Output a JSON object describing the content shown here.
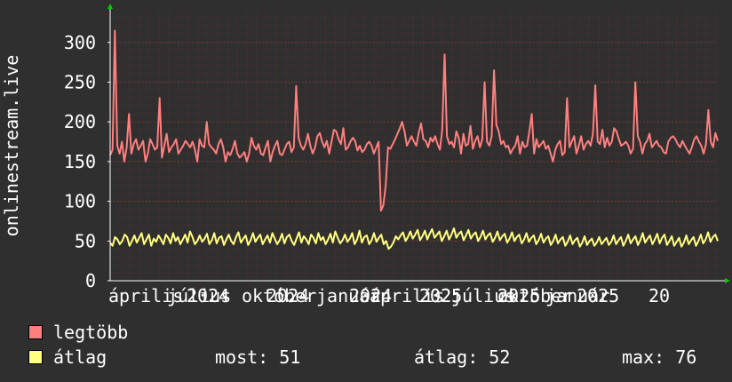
{
  "chart_data": {
    "type": "line",
    "ylabel": "onlinestream.live",
    "ylim": [
      0,
      340
    ],
    "y_ticks": [
      0,
      50,
      100,
      150,
      200,
      250,
      300
    ],
    "x_tick_labels": [
      "április",
      "2024",
      "július",
      "2024",
      "október",
      "2024",
      "január",
      "2025",
      "április",
      "2025",
      "július",
      "2025",
      "október",
      "2025",
      "január",
      "20"
    ],
    "grid": true,
    "legend_placement": "bottom-left",
    "series": [
      {
        "name": "legtöbb",
        "color": "#ff7f7f",
        "values": [
          158,
          165,
          315,
          170,
          160,
          175,
          150,
          168,
          210,
          160,
          172,
          178,
          165,
          170,
          176,
          150,
          160,
          178,
          172,
          165,
          168,
          230,
          155,
          170,
          185,
          162,
          168,
          172,
          178,
          160,
          165,
          170,
          176,
          172,
          168,
          175,
          165,
          150,
          178,
          170,
          168,
          200,
          172,
          168,
          165,
          160,
          172,
          178,
          168,
          150,
          162,
          158,
          166,
          176,
          160,
          155,
          158,
          162,
          150,
          160,
          180,
          170,
          165,
          172,
          160,
          158,
          168,
          176,
          150,
          162,
          170,
          176,
          160,
          158,
          165,
          172,
          175,
          162,
          168,
          245,
          180,
          170,
          165,
          172,
          185,
          170,
          160,
          168,
          182,
          186,
          175,
          168,
          176,
          160,
          175,
          190,
          188,
          178,
          172,
          192,
          165,
          168,
          175,
          180,
          176,
          164,
          170,
          162,
          165,
          172,
          175,
          170,
          160,
          168,
          175,
          88,
          95,
          120,
          168,
          166,
          172,
          178,
          185,
          192,
          200,
          188,
          170,
          176,
          182,
          175,
          170,
          186,
          198,
          178,
          176,
          168,
          180,
          175,
          182,
          172,
          165,
          190,
          285,
          182,
          172,
          175,
          168,
          188,
          180,
          160,
          185,
          170,
          172,
          195,
          166,
          176,
          182,
          168,
          178,
          250,
          175,
          170,
          182,
          265,
          196,
          188,
          172,
          176,
          168,
          170,
          160,
          166,
          170,
          182,
          160,
          175,
          168,
          170,
          188,
          210,
          160,
          178,
          168,
          172,
          176,
          166,
          170,
          160,
          150,
          165,
          172,
          176,
          158,
          162,
          230,
          168,
          175,
          182,
          160,
          170,
          182,
          165,
          172,
          176,
          170,
          185,
          246,
          175,
          172,
          190,
          168,
          180,
          170,
          175,
          192,
          188,
          178,
          170,
          172,
          175,
          170,
          160,
          166,
          250,
          182,
          175,
          160,
          172,
          176,
          185,
          168,
          172,
          176,
          170,
          168,
          162,
          160,
          175,
          180,
          182,
          178,
          172,
          168,
          176,
          170,
          165,
          160,
          168,
          178,
          182,
          175,
          170,
          160,
          172,
          215,
          175,
          168,
          186,
          176
        ]
      },
      {
        "name": "átlag",
        "color": "#ffff80",
        "values": [
          48,
          44,
          55,
          52,
          46,
          50,
          58,
          55,
          44,
          50,
          57,
          48,
          54,
          60,
          46,
          52,
          58,
          44,
          53,
          49,
          57,
          52,
          46,
          58,
          54,
          47,
          60,
          50,
          55,
          46,
          52,
          58,
          48,
          62,
          55,
          46,
          50,
          57,
          49,
          53,
          59,
          46,
          51,
          60,
          47,
          54,
          56,
          45,
          52,
          58,
          50,
          46,
          55,
          61,
          48,
          53,
          57,
          45,
          51,
          60,
          49,
          54,
          58,
          46,
          52,
          57,
          48,
          60,
          53,
          46,
          51,
          59,
          47,
          55,
          58,
          50,
          45,
          53,
          61,
          48,
          56,
          52,
          46,
          58,
          54,
          47,
          60,
          51,
          55,
          46,
          52,
          59,
          48,
          62,
          54,
          47,
          51,
          58,
          49,
          53,
          60,
          46,
          52,
          63,
          48,
          55,
          57,
          46,
          51,
          60,
          49,
          54,
          58,
          46,
          50,
          40,
          43,
          48,
          56,
          52,
          57,
          61,
          50,
          55,
          62,
          53,
          58,
          64,
          51,
          56,
          63,
          52,
          59,
          65,
          54,
          58,
          62,
          50,
          56,
          63,
          52,
          58,
          66,
          54,
          59,
          62,
          51,
          57,
          64,
          53,
          58,
          61,
          50,
          55,
          63,
          52,
          57,
          60,
          49,
          54,
          62,
          51,
          56,
          59,
          48,
          53,
          61,
          50,
          55,
          58,
          47,
          52,
          60,
          49,
          54,
          57,
          46,
          51,
          59,
          48,
          53,
          56,
          45,
          50,
          58,
          47,
          52,
          55,
          44,
          49,
          57,
          46,
          51,
          54,
          43,
          48,
          56,
          45,
          50,
          53,
          44,
          48,
          55,
          46,
          50,
          54,
          45,
          49,
          57,
          46,
          51,
          55,
          44,
          50,
          58,
          47,
          52,
          56,
          45,
          51,
          60,
          48,
          53,
          57,
          46,
          52,
          59,
          47,
          54,
          58,
          45,
          50,
          56,
          44,
          49,
          54,
          43,
          48,
          57,
          46,
          51,
          55,
          44,
          50,
          58,
          47,
          52,
          61,
          49,
          55,
          58,
          50
        ]
      }
    ]
  },
  "legend": {
    "items": [
      {
        "label": "legtöbb",
        "color": "#ff7f7f"
      },
      {
        "label": "átlag",
        "color": "#ffff80"
      }
    ],
    "stats": {
      "most": "most: 51",
      "atlag": "átlag: 52",
      "max": "max: 76"
    }
  },
  "colors": {
    "background": "#2f2f2f",
    "plot_area": "#2f2f2f",
    "grid_minor": "#5a2f2f",
    "grid_major": "#6a3a3a",
    "axis": "#ffffff",
    "arrow": "#00cc00"
  }
}
